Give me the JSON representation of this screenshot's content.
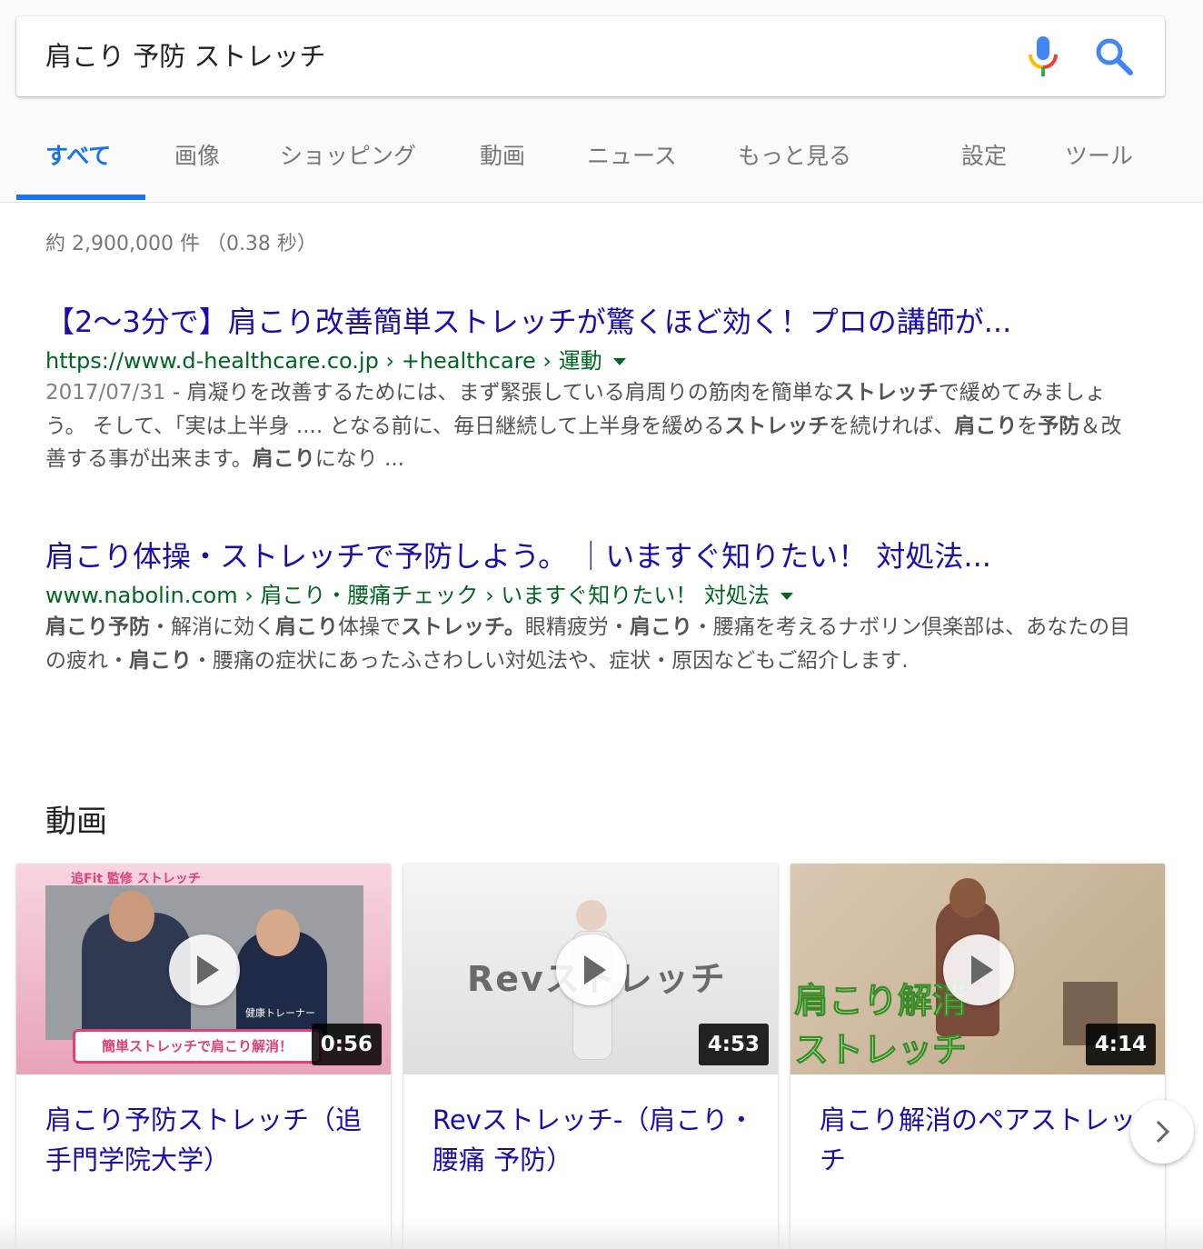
{
  "search": {
    "query": "肩こり 予防 ストレッチ",
    "mic_icon": "mic-icon",
    "search_icon": "search-icon"
  },
  "tabs": [
    {
      "label": "すべて",
      "active": true
    },
    {
      "label": "画像"
    },
    {
      "label": "ショッピング"
    },
    {
      "label": "動画"
    },
    {
      "label": "ニュース"
    },
    {
      "label": "もっと見る"
    },
    {
      "label": "設定"
    },
    {
      "label": "ツール"
    }
  ],
  "stats": "約 2,900,000 件 （0.38 秒）",
  "results": [
    {
      "title": "【2〜3分で】肩こり改善簡単ストレッチが驚くほど効く！プロの講師が...",
      "url": "https://www.d-healthcare.co.jp › +healthcare › 運動",
      "date": "2017/07/31",
      "snippet_parts": [
        {
          "t": " - 肩凝りを改善するためには、まず緊張している肩周りの筋肉を簡単な"
        },
        {
          "t": "ストレッチ",
          "b": true
        },
        {
          "t": "で緩めてみましょう。 そして、「実は上半身 .... となる前に、毎日継続して上半身を緩める"
        },
        {
          "t": "ストレッチ",
          "b": true
        },
        {
          "t": "を続ければ、"
        },
        {
          "t": "肩こり",
          "b": true
        },
        {
          "t": "を"
        },
        {
          "t": "予防",
          "b": true
        },
        {
          "t": "＆改善する事が出来ます。"
        },
        {
          "t": "肩こり",
          "b": true
        },
        {
          "t": "になり ..."
        }
      ]
    },
    {
      "title": "肩こり体操・ストレッチで予防しよう。 ｜いますぐ知りたい！ 対処法...",
      "url": "www.nabolin.com › 肩こり・腰痛チェック › いますぐ知りたい！ 対処法",
      "snippet_parts": [
        {
          "t": "肩こり予防",
          "b": true
        },
        {
          "t": "・解消に効く"
        },
        {
          "t": "肩こり",
          "b": true
        },
        {
          "t": "体操で"
        },
        {
          "t": "ストレッチ。",
          "b": true
        },
        {
          "t": "眼精疲労・"
        },
        {
          "t": "肩こり",
          "b": true
        },
        {
          "t": "・腰痛を考えるナボリン倶楽部は、あなたの目の疲れ・"
        },
        {
          "t": "肩こり",
          "b": true
        },
        {
          "t": "・腰痛の症状にあったふさわしい対処法や、症状・原因などもご紹介します."
        }
      ]
    }
  ],
  "videos": {
    "heading": "動画",
    "items": [
      {
        "title": "肩こり予防ストレッチ（追手門学院大学）",
        "duration": "0:56",
        "thumb_header": "追Fit 監修 ストレッチ",
        "thumb_banner": "簡単ストレッチで肩こり解消！",
        "thumb_caption": "健康トレーナー"
      },
      {
        "title": "Revストレッチ-（肩こり・腰痛 予防）",
        "duration": "4:53",
        "thumb_text": "Revストレッチ"
      },
      {
        "title": "肩こり解消のペアストレッチ",
        "duration": "4:14",
        "thumb_line1": "肩こり解消",
        "thumb_line2": "ストレッチ"
      }
    ]
  },
  "colors": {
    "accent": "#1a73e8",
    "link": "#1a0dab",
    "url_green": "#006621",
    "snippet": "#545454"
  }
}
